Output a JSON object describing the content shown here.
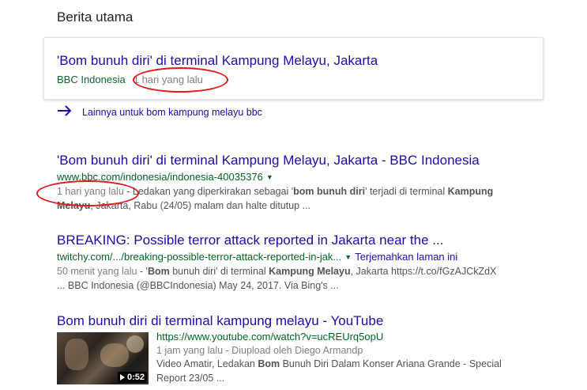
{
  "section": {
    "title": "Berita utama"
  },
  "top_card": {
    "title": "'Bom bunuh diri' di terminal Kampung Melayu, Jakarta",
    "source": "BBC Indonesia",
    "time": "1 hari yang lalu"
  },
  "more_link": {
    "label": "Lainnya untuk bom kampung melayu bbc"
  },
  "results": [
    {
      "title": "'Bom bunuh diri' di terminal Kampung Melayu, Jakarta - BBC Indonesia",
      "url": "www.bbc.com/indonesia/indonesia-40035376",
      "date": "1 hari yang lalu",
      "snippet": {
        "l1a": " - Ledakan yang diperkirakan sebagai '",
        "l1b": "bom bunuh diri",
        "l1c": "' terjadi di terminal ",
        "l1d": "Kampung",
        "l2a": "Melayu",
        "l2b": ", Jakarta, Rabu (24/05) malam dan halte ditutup ..."
      }
    },
    {
      "title": "BREAKING: Possible terror attack reported in Jakarta near the ...",
      "url": "twitchy.com/.../breaking-possible-terror-attack-reported-in-jak...",
      "translate": "Terjemahkan laman ini",
      "date": "50 menit yang lalu",
      "snippet": {
        "l1a": " - '",
        "l1b": "Bom",
        "l1c": " bunuh diri' di terminal ",
        "l1d": "Kampung Melayu",
        "l1e": ", Jakarta https://t.co/fGzAJCkZdX",
        "l2a": "... BBC Indonesia (@BBCIndonesia) May 24, 2017. Via Bing's ..."
      }
    },
    {
      "title": "Bom bunuh diri di terminal kampung melayu - YouTube",
      "url": "https://www.youtube.com/watch?v=ucREUrq5opU",
      "meta": "1 jam yang lalu - Diupload oleh Diego Armandp",
      "duration": "0:52",
      "snippet": {
        "l1a": "Video Amatir, Ledakan ",
        "l1b": "Bom",
        "l1c": " Bunuh Diri Dalam Konser Ariana Grande - Special",
        "l2a": "Report 23/05 ..."
      }
    }
  ],
  "colors": {
    "link": "#1a0dab",
    "url": "#006621",
    "snippet": "#545454",
    "annotation": "#e0191c"
  }
}
